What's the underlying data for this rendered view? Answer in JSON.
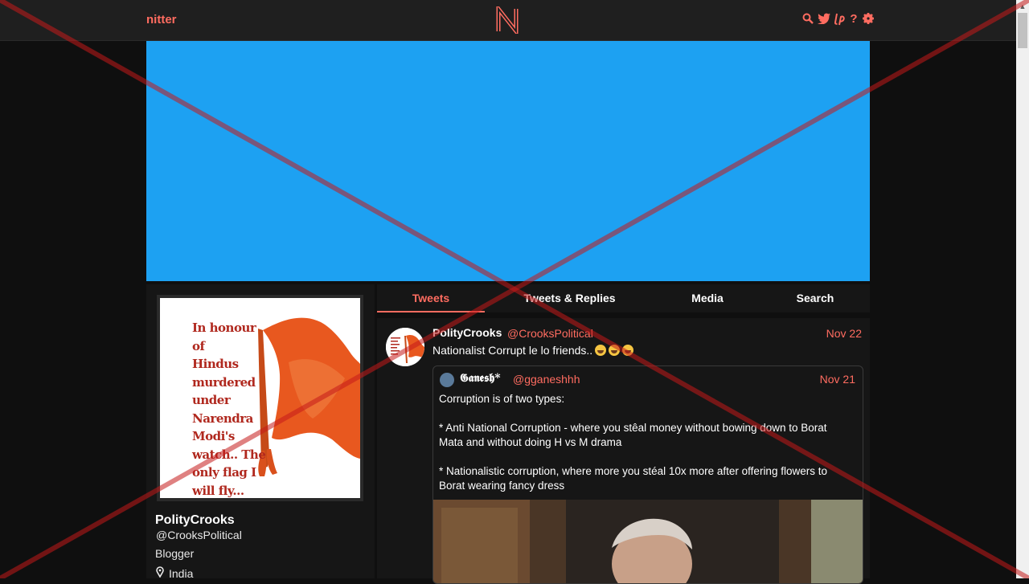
{
  "nav": {
    "brand": "nitter",
    "logo_letter": "N",
    "icons": [
      "search-icon",
      "twitter-icon",
      "liberapay-icon",
      "help-icon",
      "gear-icon"
    ],
    "help_glyph": "?"
  },
  "colors": {
    "accent": "#ff6c60",
    "banner": "#1da1f2",
    "background": "#0f0f0f",
    "panel": "#161616"
  },
  "profile": {
    "name": "PolityCrooks",
    "handle": "@CrooksPolitical",
    "bio": "Blogger",
    "location": "India",
    "avatar_text": "In honour of Hindus murdered under Narendra Modi's watch.. The only flag I will fly..."
  },
  "tabs": [
    {
      "label": "Tweets",
      "active": true
    },
    {
      "label": "Tweets & Replies",
      "active": false
    },
    {
      "label": "Media",
      "active": false
    },
    {
      "label": "Search",
      "active": false
    }
  ],
  "tweet": {
    "name": "PolityCrooks",
    "handle": "@CrooksPolitical",
    "date": "Nov 22",
    "text": "Nationalist Corrupt le lo friends..",
    "emoji_count": 3,
    "quote": {
      "name": "𝕲𝖆𝖓𝖊𝖘𝖍*",
      "handle": "@gganeshhh",
      "date": "Nov 21",
      "line1": "Corruption is of two types:",
      "line2": "* Anti National Corruption - where you stêal money without bowing down to Borat Mata and without doing H vs M drama",
      "line3": "* Nationalistic corruption, where more you stéal 10x more after offering flowers to Borat wearing fancy dress"
    }
  }
}
